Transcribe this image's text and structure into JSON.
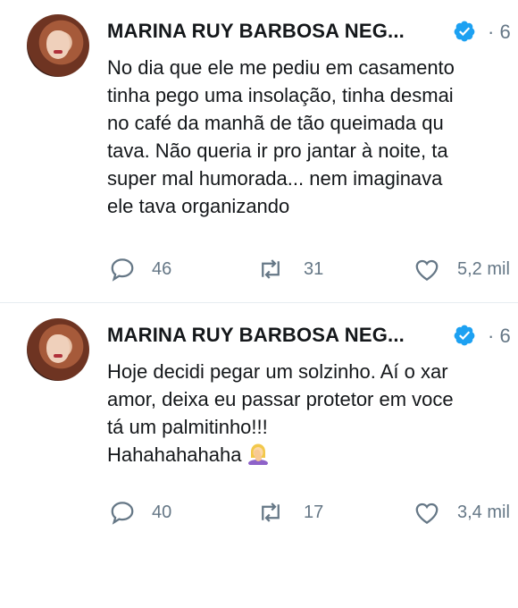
{
  "tweets": [
    {
      "author": "MARINA RUY BARBOSA NEG...",
      "time": "· 6",
      "lines": [
        "No dia que ele me pediu em casamento",
        "tinha pego uma insolação, tinha desmai",
        "no café da manhã de tão queimada qu",
        "tava. Não queria ir pro jantar à noite, ta",
        "super mal humorada... nem imaginava",
        "ele tava organizando"
      ],
      "replies": "46",
      "retweets": "31",
      "likes": "5,2 mil"
    },
    {
      "author": "MARINA RUY BARBOSA NEG...",
      "time": "· 6",
      "lines": [
        "Hoje decidi pegar um solzinho. Aí o xar",
        "amor, deixa eu passar protetor em voce",
        "tá um palmitinho!!!",
        "Hahahahahaha"
      ],
      "emoji": "woman-facepalming-emoji",
      "replies": "40",
      "retweets": "17",
      "likes": "3,4 mil"
    }
  ],
  "colors": {
    "verified": "#1da1f2",
    "muted": "#657786",
    "divider": "#e6ecf0",
    "text": "#14171a"
  },
  "icons": [
    "reply-icon",
    "retweet-icon",
    "like-icon",
    "verified-badge-icon"
  ]
}
